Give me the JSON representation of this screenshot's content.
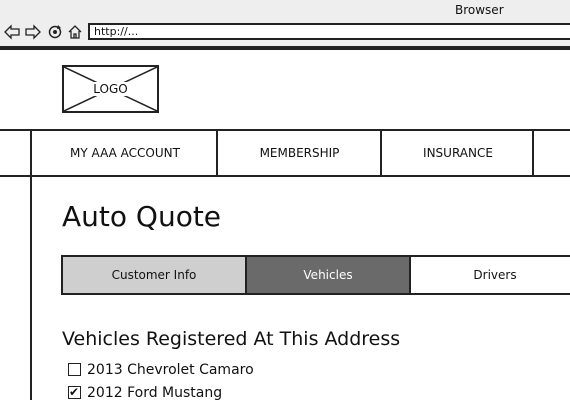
{
  "browser": {
    "title": "Browser",
    "url": "http://..."
  },
  "logo": {
    "label": "LOGO"
  },
  "nav": {
    "items": [
      "MY AAA ACCOUNT",
      "MEMBERSHIP",
      "INSURANCE"
    ]
  },
  "page": {
    "title": "Auto Quote"
  },
  "tabs": [
    {
      "label": "Customer Info",
      "state": "completed"
    },
    {
      "label": "Vehicles",
      "state": "active"
    },
    {
      "label": "Drivers",
      "state": "inactive"
    }
  ],
  "vehicles": {
    "heading": "Vehicles Registered At This Address",
    "items": [
      {
        "label": "2013 Chevrolet Camaro",
        "checked": false
      },
      {
        "label": "2012 Ford Mustang",
        "checked": true
      }
    ]
  },
  "colors": {
    "tab_completed": "#cfcfcf",
    "tab_active": "#6a6a6a",
    "tab_inactive": "#ffffff",
    "chrome": "#eeeeee"
  }
}
